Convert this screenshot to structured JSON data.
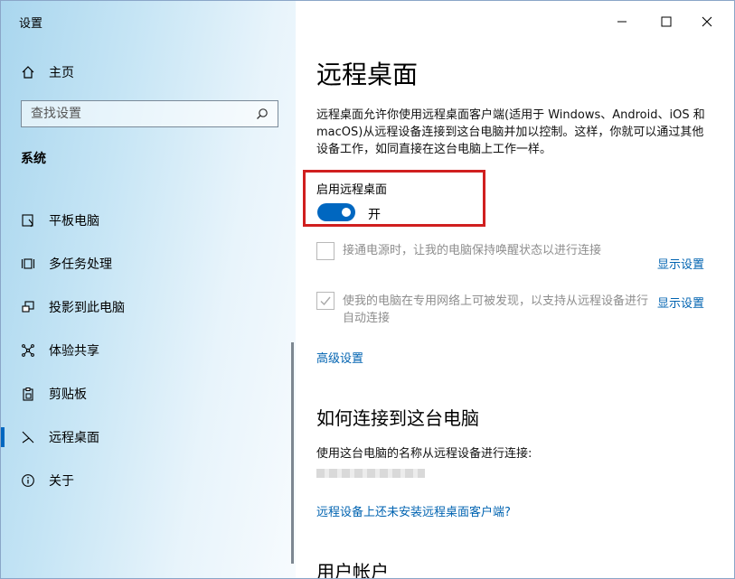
{
  "window": {
    "title": "设置",
    "controls": {
      "minimize": "minimize-icon",
      "maximize": "maximize-icon",
      "close": "close-icon"
    }
  },
  "sidebar": {
    "home_label": "主页",
    "search": {
      "placeholder": "查找设置"
    },
    "section_heading": "系统",
    "items": [
      {
        "label": "平板电脑",
        "icon": "tablet-icon"
      },
      {
        "label": "多任务处理",
        "icon": "multitasking-icon"
      },
      {
        "label": "投影到此电脑",
        "icon": "project-icon"
      },
      {
        "label": "体验共享",
        "icon": "share-icon"
      },
      {
        "label": "剪贴板",
        "icon": "clipboard-icon"
      },
      {
        "label": "远程桌面",
        "icon": "remote-desktop-icon",
        "active": true
      },
      {
        "label": "关于",
        "icon": "info-icon"
      }
    ]
  },
  "main": {
    "title": "远程桌面",
    "description": "远程桌面允许你使用远程桌面客户端(适用于 Windows、Android、iOS 和 macOS)从远程设备连接到这台电脑并加以控制。这样，你就可以通过其他设备工作，如同直接在这台电脑上工作一样。",
    "enable_label": "启用远程桌面",
    "toggle_state": "开",
    "option1_text": "接通电源时，让我的电脑保持唤醒状态以进行连接",
    "option1_link": "显示设置",
    "option2_text": "使我的电脑在专用网络上可被发现，以支持从远程设备进行自动连接",
    "option2_link": "显示设置",
    "advanced_link": "高级设置",
    "connect_heading": "如何连接到这台电脑",
    "connect_text": "使用这台电脑的名称从远程设备进行连接:",
    "client_link": "远程设备上还未安装远程桌面客户端?",
    "accounts_heading": "用户帐户"
  },
  "colors": {
    "accent": "#0067c0",
    "link": "#0063b1",
    "highlight": "#d01f1f"
  }
}
